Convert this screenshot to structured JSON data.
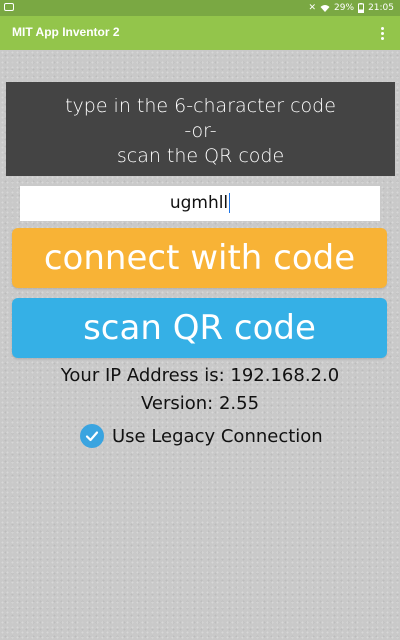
{
  "status_bar": {
    "icons": [
      "notification-icon",
      "mute-icon",
      "wifi-icon",
      "battery-icon"
    ],
    "battery": "29%",
    "time": "21:05"
  },
  "app_bar": {
    "title": "MIT App Inventor 2",
    "menu_icon": "overflow-menu-icon",
    "color": "#93c54b"
  },
  "instructions": {
    "line1": "type in the 6-character code",
    "line2": "-or-",
    "line3": "scan the QR code"
  },
  "code_input": {
    "value": "ugmhll"
  },
  "buttons": {
    "connect_label": "connect with code",
    "connect_color": "#f8b336",
    "scan_label": "scan QR code",
    "scan_color": "#35b0e6"
  },
  "info": {
    "ip": "Your IP Address is: 192.168.2.0",
    "version": "Version: 2.55"
  },
  "legacy_connection": {
    "label": "Use Legacy Connection",
    "checked": true
  }
}
